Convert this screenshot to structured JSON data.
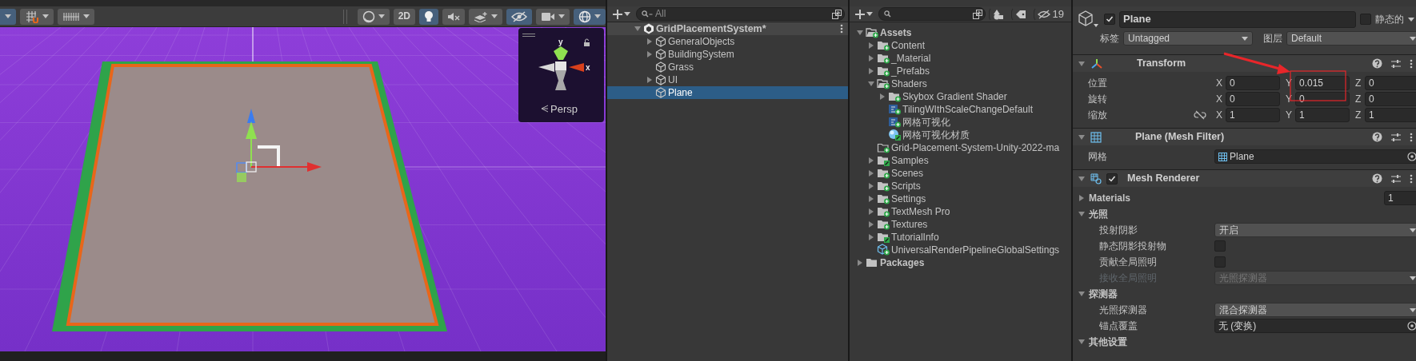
{
  "scene_view": {
    "toolbar_left": [
      {
        "kind": "overlay-menu",
        "active": true,
        "dropdown": true
      },
      {
        "kind": "grid-snap",
        "active": false,
        "dropdown": true
      },
      {
        "kind": "increment-snap",
        "active": false,
        "dropdown": true
      }
    ],
    "toolbar_right": [
      {
        "kind": "shading",
        "active": false,
        "dropdown": true
      },
      {
        "kind": "dimension",
        "label": "2D",
        "active": false,
        "dropdown": false
      },
      {
        "kind": "lighting",
        "active": true,
        "dropdown": false
      },
      {
        "kind": "audio",
        "active": false,
        "dropdown": false
      },
      {
        "kind": "effects",
        "active": false,
        "dropdown": true
      },
      {
        "kind": "hidden",
        "active": true,
        "dropdown": false
      },
      {
        "kind": "camera",
        "active": false,
        "dropdown": true
      },
      {
        "kind": "gizmos",
        "active": true,
        "dropdown": true
      }
    ],
    "orientation_gizmo": {
      "y_label": "y",
      "x_label": "x",
      "projection": "Persp"
    }
  },
  "hierarchy": {
    "search": {
      "placeholder": "All"
    },
    "scene": {
      "name": "GridPlacementSystem*",
      "expanded": true,
      "children": [
        {
          "name": "GeneralObjects",
          "expanded": false,
          "selected": false
        },
        {
          "name": "BuildingSystem",
          "expanded": false,
          "selected": false
        },
        {
          "name": "Grass",
          "selected": false
        },
        {
          "name": "UI",
          "expanded": false,
          "selected": false
        },
        {
          "name": "Plane",
          "selected": true
        }
      ]
    }
  },
  "project": {
    "hidden_count": "19",
    "tree": [
      {
        "name": "Assets",
        "kind": "folder",
        "tracked": true,
        "modified": false,
        "expanded": true,
        "children": [
          {
            "name": "Content",
            "kind": "folder",
            "tracked": true,
            "modified": false,
            "expanded": false
          },
          {
            "name": "_Material",
            "kind": "folder",
            "tracked": true,
            "modified": false,
            "expanded": false
          },
          {
            "name": "_Prefabs",
            "kind": "folder",
            "tracked": true,
            "modified": false,
            "expanded": false
          },
          {
            "name": "Shaders",
            "kind": "folder",
            "tracked": true,
            "modified": false,
            "expanded": true,
            "children": [
              {
                "name": "Skybox Gradient Shader",
                "kind": "folder",
                "tracked": true,
                "modified": false,
                "expanded": false
              },
              {
                "name": "TilingWIthScaleChangeDefault",
                "kind": "shader",
                "tracked": true,
                "modified": false
              },
              {
                "name": "网格可视化",
                "kind": "shader",
                "tracked": true,
                "modified": false
              },
              {
                "name": "网格可视化材质",
                "kind": "material",
                "tracked": true,
                "modified": true
              }
            ]
          },
          {
            "name": "Grid-Placement-System-Unity-2022-ma",
            "kind": "empty-folder",
            "tracked": true,
            "modified": false
          },
          {
            "name": "Samples",
            "kind": "folder",
            "tracked": true,
            "modified": true,
            "expanded": false
          },
          {
            "name": "Scenes",
            "kind": "folder",
            "tracked": true,
            "modified": false,
            "expanded": false
          },
          {
            "name": "Scripts",
            "kind": "folder",
            "tracked": true,
            "modified": false,
            "expanded": false
          },
          {
            "name": "Settings",
            "kind": "folder",
            "tracked": true,
            "modified": false,
            "expanded": false
          },
          {
            "name": "TextMesh Pro",
            "kind": "folder",
            "tracked": true,
            "modified": false,
            "expanded": false
          },
          {
            "name": "Textures",
            "kind": "folder",
            "tracked": true,
            "modified": false,
            "expanded": false
          },
          {
            "name": "TutorialInfo",
            "kind": "folder",
            "tracked": true,
            "modified": true,
            "expanded": false
          },
          {
            "name": "UniversalRenderPipelineGlobalSettings",
            "kind": "settings",
            "tracked": true,
            "modified": false
          }
        ]
      },
      {
        "name": "Packages",
        "kind": "folder",
        "tracked": false,
        "expanded": false
      }
    ]
  },
  "inspector": {
    "object": {
      "active": true,
      "name": "Plane",
      "static": false,
      "static_label": "静态的",
      "tag_label": "标签",
      "tag": "Untagged",
      "layer_label": "图层",
      "layer": "Default"
    },
    "components": [
      {
        "kind": "transform",
        "title": "Transform",
        "expanded": true,
        "rows": [
          {
            "kind": "vector",
            "label": "位置",
            "fields": [
              {
                "axis": "X",
                "value": "0"
              },
              {
                "axis": "Y",
                "value": "0.015"
              },
              {
                "axis": "Z",
                "value": "0"
              }
            ]
          },
          {
            "kind": "vector",
            "label": "旋转",
            "fields": [
              {
                "axis": "X",
                "value": "0"
              },
              {
                "axis": "Y",
                "value": "0"
              },
              {
                "axis": "Z",
                "value": "0"
              }
            ]
          },
          {
            "kind": "scale",
            "label": "缩放",
            "fields": [
              {
                "axis": "X",
                "value": "1"
              },
              {
                "axis": "Y",
                "value": "1"
              },
              {
                "axis": "Z",
                "value": "1"
              }
            ]
          }
        ]
      },
      {
        "kind": "mesh-filter",
        "title": "Plane (Mesh Filter)",
        "expanded": true,
        "rows": [
          {
            "kind": "object",
            "label": "网格",
            "value": "Plane"
          }
        ]
      },
      {
        "kind": "mesh-renderer",
        "title": "Mesh Renderer",
        "enabled": true,
        "expanded": true,
        "rows": [
          {
            "kind": "array",
            "label": "Materials",
            "expanded": false,
            "value": "1"
          },
          {
            "kind": "section",
            "label": "光照",
            "expanded": true,
            "children": [
              {
                "kind": "dropdown",
                "label": "投射阴影",
                "value": "开启",
                "disabled": false
              },
              {
                "kind": "checkbox",
                "label": "静态阴影投射物",
                "checked": false
              },
              {
                "kind": "checkbox",
                "label": "贡献全局照明",
                "checked": false
              },
              {
                "kind": "dropdown",
                "label": "接收全局照明",
                "value": "光照探测器",
                "disabled": true
              }
            ]
          },
          {
            "kind": "section",
            "label": "探测器",
            "expanded": true,
            "children": [
              {
                "kind": "dropdown",
                "label": "光照探测器",
                "value": "混合探测器",
                "disabled": false
              },
              {
                "kind": "object",
                "label": "锚点覆盖",
                "value": "无 (变换)"
              }
            ]
          },
          {
            "kind": "section",
            "label": "其他设置",
            "expanded": true,
            "children": []
          }
        ]
      }
    ],
    "annotations": {
      "arrow": true,
      "highlight_box": true
    }
  }
}
